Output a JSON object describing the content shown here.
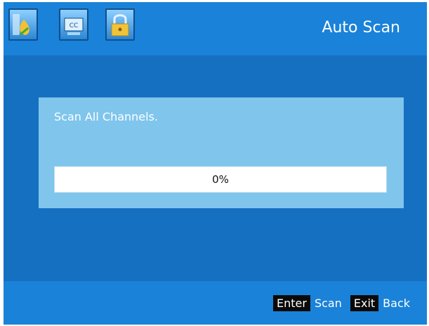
{
  "header": {
    "title": "Auto Scan",
    "icons": [
      {
        "name": "picture-icon"
      },
      {
        "name": "cc-icon",
        "label": "CC"
      },
      {
        "name": "lock-icon"
      }
    ]
  },
  "panel": {
    "message": "Scan All Channels.",
    "progress_text": "0%",
    "progress_value": 0
  },
  "footer": {
    "enter_key": "Enter",
    "enter_action": "Scan",
    "exit_key": "Exit",
    "exit_action": "Back"
  },
  "colors": {
    "background": "#1670c2",
    "bars": "#1a82d8",
    "panel": "#7fc5ec"
  }
}
